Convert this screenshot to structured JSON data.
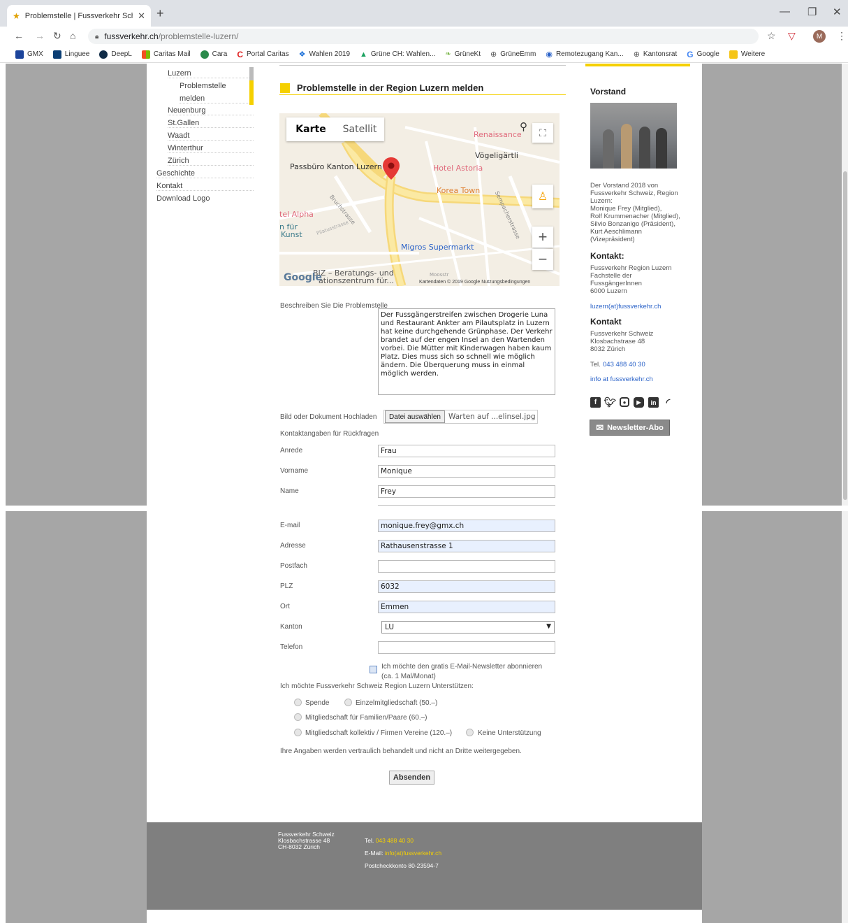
{
  "browser": {
    "tab_title": "Problemstelle | Fussverkehr Schw",
    "url_host": "fussverkehr.ch",
    "url_path": "/problemstelle-luzern/",
    "profile_initial": "M",
    "bookmarks": [
      "GMX",
      "Linguee",
      "DeepL",
      "Caritas Mail",
      "Cara",
      "Portal Caritas",
      "Wahlen 2019",
      "Grüne CH: Wahlen...",
      "GrüneKt",
      "GrüneEmm",
      "Remotezugang Kan...",
      "Kantonsrat",
      "Google",
      "Weitere"
    ]
  },
  "left_nav": {
    "items": [
      "Luzern",
      "Problemstelle",
      "melden",
      "Neuenburg",
      "St.Gallen",
      "Waadt",
      "Winterthur",
      "Zürich",
      "Geschichte",
      "Kontakt",
      "Download Logo"
    ]
  },
  "main": {
    "heading": "Problemstelle in der Region Luzern melden",
    "map": {
      "tab_map": "Karte",
      "tab_satellite": "Satellit",
      "labels": [
        "Passbüro Kanton Luzern",
        "Renaissance",
        "Vögeligärtli",
        "Hotel Astoria",
        "Korea Town",
        "tel Alpha",
        "n für",
        "Kunst",
        "Migros Supermarkt",
        "Bruchstrasse",
        "Pilatusstrasse",
        "Sempacherstrasse",
        "BIZ – Beratungs- und",
        "ationszentrum für...",
        "Moosstr"
      ],
      "google": "Google",
      "footer": "Kartendaten © 2019 Google   Nutzungsbedingungen"
    },
    "describe_label": "Beschreiben Sie Die Problemstelle",
    "describe_text": "Der Fussgängerstreifen zwischen Drogerie Luna und Restaurant Ankter am Pilautsplatz in Luzern hat keine durchgehende Grünphase. Der Verkehr brandet auf der engen Insel an den Wartenden vorbei. Die Mütter mit Kinderwagen haben kaum Platz. Dies muss sich so schnell wie möglich ändern. Die Überquerung muss in einmal möglich werden.",
    "upload_label": "Bild oder Dokument Hochladen",
    "upload_button": "Datei auswählen",
    "upload_file": "Warten auf ...elinsel.jpg",
    "contact_heading": "Kontaktangaben für Rückfragen",
    "fields": {
      "anrede": {
        "label": "Anrede",
        "value": "Frau"
      },
      "vorname": {
        "label": "Vorname",
        "value": "Monique"
      },
      "name": {
        "label": "Name",
        "value": "Frey"
      },
      "email": {
        "label": "E-mail",
        "value": "monique.frey@gmx.ch"
      },
      "adresse": {
        "label": "Adresse",
        "value": "Rathausenstrasse 1"
      },
      "postfach": {
        "label": "Postfach",
        "value": ""
      },
      "plz": {
        "label": "PLZ",
        "value": "6032"
      },
      "ort": {
        "label": "Ort",
        "value": "Emmen"
      },
      "kanton": {
        "label": "Kanton",
        "value": "LU"
      },
      "telefon": {
        "label": "Telefon",
        "value": ""
      }
    },
    "newsletter_check_line1": "Ich möchte den gratis E-Mail-Newsletter abonnieren",
    "newsletter_check_line2": "(ca. 1 Mal/Monat)",
    "support_heading": "Ich möchte Fussverkehr Schweiz Region Luzern Unterstützen:",
    "support_options": [
      "Spende",
      "Einzelmitgliedschaft (50.–)",
      "Mitgliedschaft für Familien/Paare (60.–)",
      "Mitgliedschaft kollektiv / Firmen Vereine (120.–)",
      "Keine Unterstützung"
    ],
    "privacy_note": "Ihre Angaben werden vertraulich behandelt und nicht an Dritte weitergegeben.",
    "submit_label": "Absenden"
  },
  "sidebar": {
    "vorstand_title": "Vorstand",
    "vorstand_text": "Der Vorstand 2018 von\nFussverkehr Schweiz, Region\nLuzern:\nMonique Frey (Mitglied),\nRolf Krummenacher (Mitglied),\nSilvio Bonzanigo (Präsident),\nKurt Aeschlimann\n(Vizepräsident)",
    "kontakt1_title": "Kontakt:",
    "kontakt1_text": "Fussverkehr Region Luzern\nFachstelle der\nFussgängerInnen\n6000 Luzern",
    "kontakt1_email": "luzern(at)fussverkehr.ch",
    "kontakt2_title": "Kontakt",
    "kontakt2_text": "Fussverkehr Schweiz\nKlosbachstrase 48\n8032 Zürich",
    "tel_label": "Tel.",
    "tel": "043 488 40 30",
    "email": "info at fussverkehr.ch",
    "social": [
      "facebook-icon",
      "twitter-icon",
      "instagram-icon",
      "youtube-icon",
      "linkedin-icon",
      "rss-icon"
    ],
    "newsletter_button": "Newsletter-Abo"
  },
  "footer": {
    "address": "Fussverkehr Schweiz\nKlosbachstrasse 48\nCH-8032 Zürich",
    "tel_label": "Tel.",
    "tel": "043 488 40 30",
    "email_label": "E-Mail:",
    "email": "info(at)fussverkehr.ch",
    "postcheck": "Postcheckkonto 80-23594-7"
  },
  "colors": {
    "accent_yellow": "#f5d000",
    "gutter_gray": "#a6a6a6",
    "footer_gray": "#7f7f7f",
    "link_blue": "#2a62c8"
  }
}
